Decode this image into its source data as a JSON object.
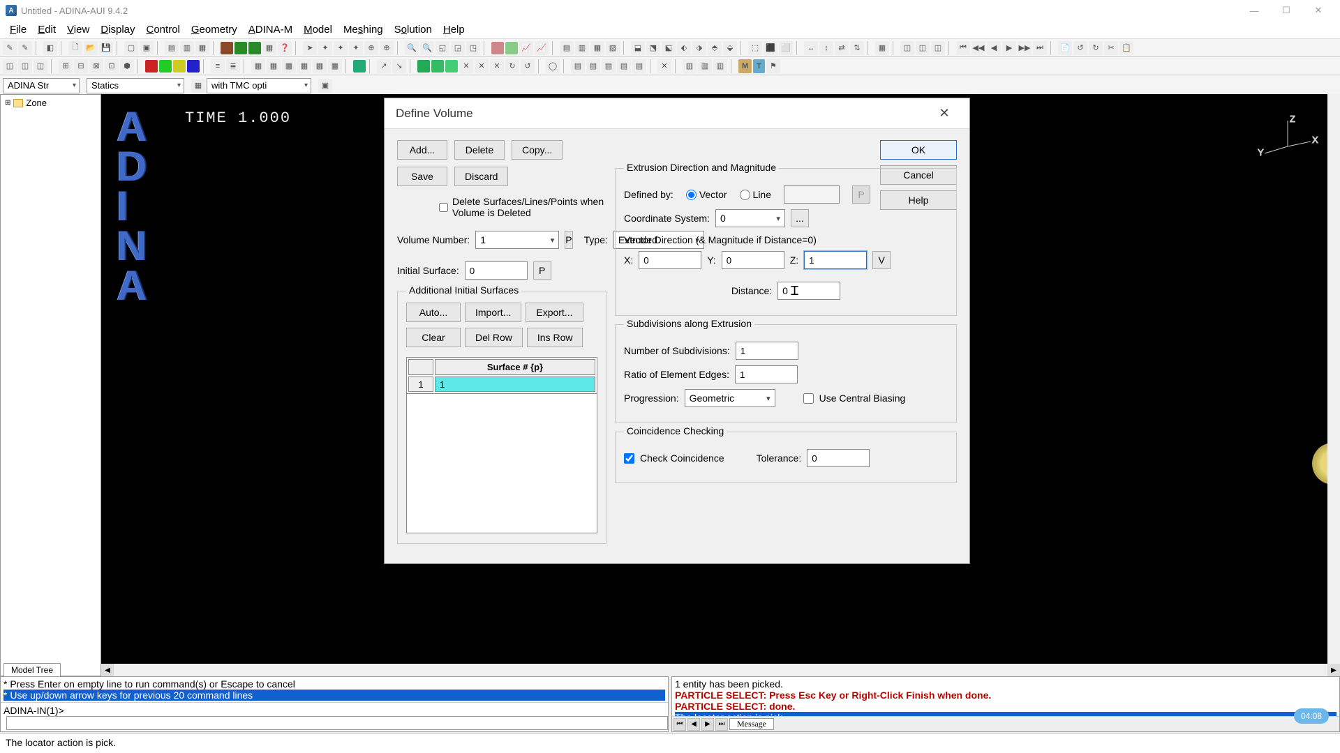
{
  "titlebar": {
    "title": "Untitled - ADINA-AUI  9.4.2",
    "app_icon": "A"
  },
  "menubar": [
    "File",
    "Edit",
    "View",
    "Display",
    "Control",
    "Geometry",
    "ADINA-M",
    "Model",
    "Meshing",
    "Solution",
    "Help"
  ],
  "combos": {
    "module": "ADINA Str",
    "analysis": "Statics",
    "opt": "with TMC opti"
  },
  "tree": {
    "root": "Zone",
    "tab": "Model Tree"
  },
  "viewport": {
    "time": "TIME 1.000",
    "logo": [
      "A",
      "D",
      "I",
      "N",
      "A"
    ],
    "axes": [
      "X",
      "Y",
      "Z"
    ]
  },
  "dialog": {
    "title": "Define Volume",
    "topbuttons": [
      "Add...",
      "Delete",
      "Copy...",
      "Save",
      "Discard"
    ],
    "rightbuttons": [
      "OK",
      "Cancel",
      "Help"
    ],
    "del_surfaces_label": "Delete Surfaces/Lines/Points when Volume is Deleted",
    "vol_num_label": "Volume Number:",
    "vol_num": "1",
    "type_label": "Type:",
    "type": "Extruded",
    "init_surf_label": "Initial Surface:",
    "init_surf": "0",
    "additional_title": "Additional Initial Surfaces",
    "addbtns1": [
      "Auto...",
      "Import...",
      "Export..."
    ],
    "addbtns2": [
      "Clear",
      "Del Row",
      "Ins Row"
    ],
    "tbl_header": "Surface # {p}",
    "tbl_rownum": "1",
    "tbl_val": "1",
    "extrusion_title": "Extrusion Direction and Magnitude",
    "defined_by": "Defined by:",
    "vector": "Vector",
    "line": "Line",
    "coord_label": "Coordinate System:",
    "coord": "0",
    "vecdir_label": "Vector Direction (& Magnitude if Distance=0)",
    "x_label": "X:",
    "x": "0",
    "y_label": "Y:",
    "y": "0",
    "z_label": "Z:",
    "z": "1",
    "dist_label": "Distance:",
    "dist": "0",
    "subdiv_title": "Subdivisions along Extrusion",
    "numsub_label": "Number of Subdivisions:",
    "numsub": "1",
    "ratio_label": "Ratio of Element Edges:",
    "ratio": "1",
    "prog_label": "Progression:",
    "prog": "Geometric",
    "central_label": "Use Central Biasing",
    "coinc_title": "Coincidence Checking",
    "check_coinc_label": "Check Coincidence",
    "tol_label": "Tolerance:",
    "tol": "0",
    "p_btn": "P",
    "v_btn": "V",
    "dots": "..."
  },
  "console_left": {
    "line1": "* Press Enter on empty line to run command(s) or Escape to cancel",
    "line2": "* Use up/down arrow keys for previous 20 command lines",
    "prompt": "ADINA-IN(1)>"
  },
  "console_right": {
    "line1": "1 entity has been picked.",
    "line2": "PARTICLE SELECT: Press Esc Key or Right-Click Finish when done.",
    "line3": "PARTICLE SELECT: done.",
    "line4": "The locator action is pick.",
    "tab": "Message"
  },
  "statusbar": "The locator action is pick.",
  "time_badge": "04:08"
}
